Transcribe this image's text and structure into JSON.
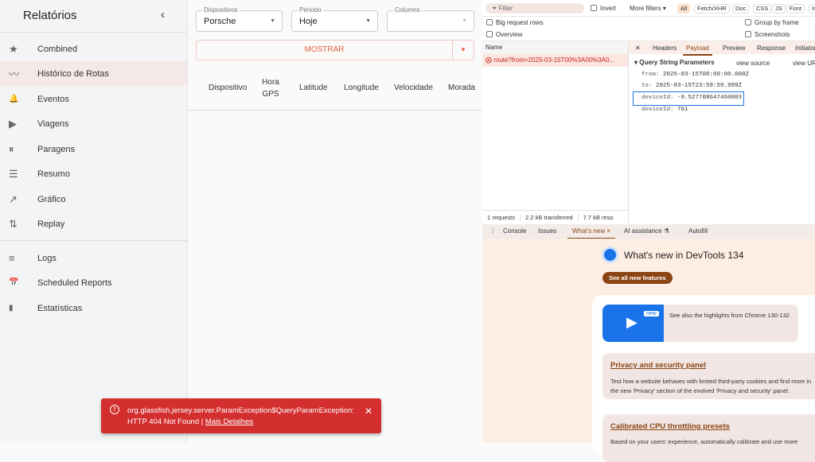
{
  "sidebar": {
    "title": "Relatórios",
    "collapse_icon": "‹",
    "items": [
      {
        "label": "Combined",
        "icon": "★"
      },
      {
        "label": "Histórico de Rotas",
        "icon": "〰"
      },
      {
        "label": "Eventos",
        "icon": "🔔"
      },
      {
        "label": "Viagens",
        "icon": "▶"
      },
      {
        "label": "Paragens",
        "icon": "⏸"
      },
      {
        "label": "Resumo",
        "icon": "☰"
      },
      {
        "label": "Gráfico",
        "icon": "↗"
      },
      {
        "label": "Replay",
        "icon": "⇅"
      }
    ],
    "items2": [
      {
        "label": "Logs",
        "icon": "≡"
      },
      {
        "label": "Scheduled Reports",
        "icon": "📅"
      },
      {
        "label": "Estatísticas",
        "icon": "▮"
      }
    ]
  },
  "filters": {
    "device": {
      "label": "Dispositivos",
      "value": "Porsche"
    },
    "period": {
      "label": "Periodo",
      "value": "Hoje"
    },
    "columns": {
      "label": "Columns",
      "value": ""
    },
    "show_button": "MOSTRAR"
  },
  "table": {
    "headers": [
      "Dispositivo",
      "Hora GPS",
      "Latitude",
      "Longitude",
      "Velocidade",
      "Morada"
    ]
  },
  "toast": {
    "message": "org.glassfish.jersey.server.ParamException$QueryParamException: HTTP 404 Not Found | ",
    "link": "Mais Detalhes"
  },
  "devtools": {
    "filter_placeholder": "Filter",
    "invert": "Invert",
    "more_filters": "More filters ▾",
    "type_filters": [
      "All",
      "Fetch/XHR",
      "Doc",
      "CSS",
      "JS",
      "Font",
      "Im"
    ],
    "big_rows": "Big request rows",
    "overview": "Overview",
    "group_by_frame": "Group by frame",
    "screenshots": "Screenshots",
    "name_header": "Name",
    "request": "route?from=2025-03-15T00%3A00%3A0...",
    "detail_tabs": [
      "Headers",
      "Payload",
      "Preview",
      "Response",
      "Initiator"
    ],
    "qs_title": "Query String Parameters",
    "view_source": "view source",
    "view_url": "view URL",
    "params": [
      {
        "key": "from:",
        "value": "2025-03-15T00:00:00.000Z"
      },
      {
        "key": "to:",
        "value": "2025-03-15T23:59:59.999Z"
      },
      {
        "key": "deviceId:",
        "value": "-9.527708647460003"
      },
      {
        "key": "deviceId:",
        "value": "761"
      }
    ],
    "status": [
      "1 requests",
      "2.2 kB transferred",
      "7.7 kB reso"
    ],
    "drawer_tabs": [
      "Console",
      "Issues",
      "What's new",
      "AI assistance",
      "Autofill"
    ],
    "whatsnew_title": "What's new in DevTools 134",
    "see_all": "See all new features",
    "new_badge": "new",
    "highlights": "See also the highlights from Chrome 130-132",
    "card1_title": "Privacy and security panel",
    "card1_text": "Test how a website behaves with limited third-party cookies and find more in the new 'Privacy' section of the evolved 'Privacy and security' panel.",
    "card2_title": "Calibrated CPU throttling presets",
    "card2_text": "Based on your users' experience, automatically calibrate and use more"
  }
}
